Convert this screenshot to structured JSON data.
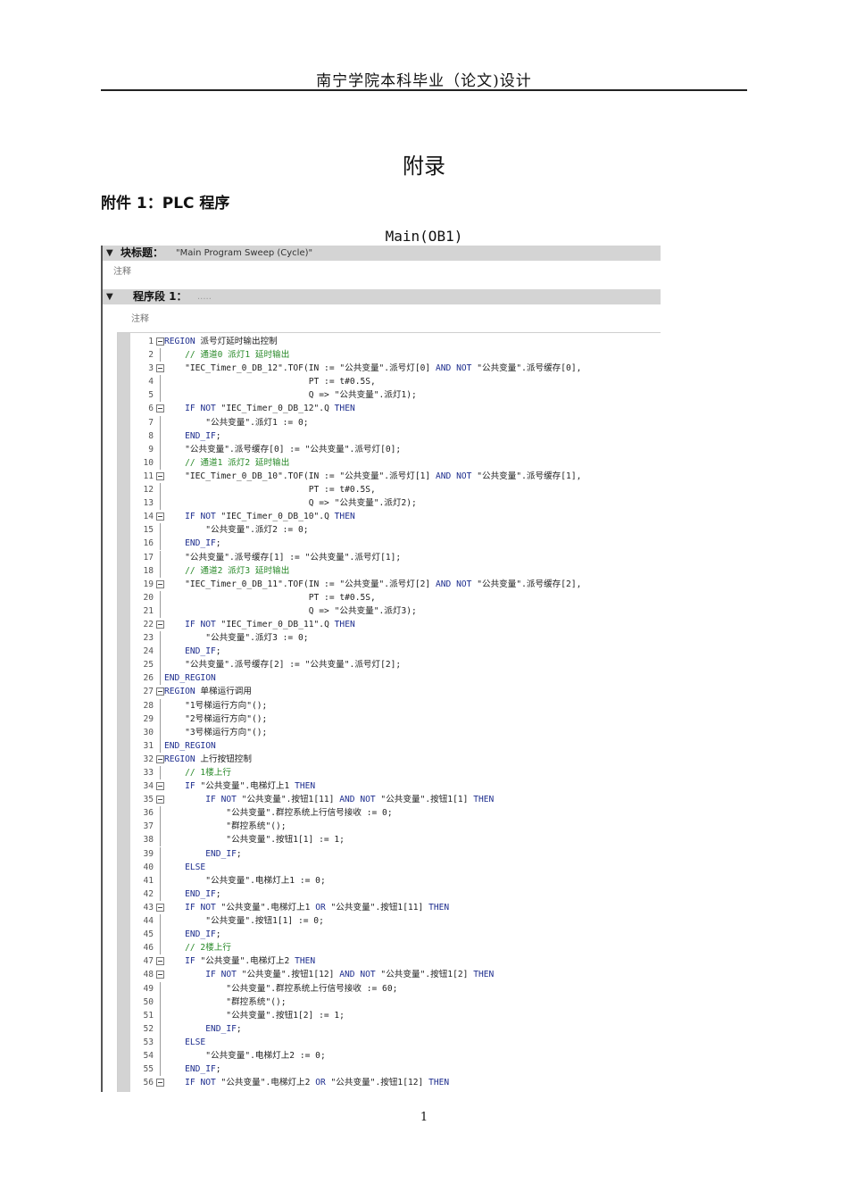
{
  "header": {
    "title": "南宁学院本科毕业（论文)设计"
  },
  "appendix_title": "附录",
  "attachment_title": "附件 1：PLC 程序",
  "figure_title": "Main(OB1)",
  "block": {
    "title_label": "块标题：",
    "title_value": "\"Main Program Sweep (Cycle)\"",
    "comment": "注释"
  },
  "network": {
    "label": "程序段 1：",
    "placeholder": ".....",
    "comment": "注释"
  },
  "code_lines": [
    {
      "n": "1",
      "t": "REGION 派号灯延时输出控制",
      "fold": true,
      "s": "kw"
    },
    {
      "n": "2",
      "t": "    // 通道0 派灯1 延时输出",
      "s": "cm"
    },
    {
      "n": "3",
      "t": "    \"IEC_Timer_0_DB_12\".TOF(IN := \"公共变量\".派号灯[0] AND NOT \"公共变量\".派号缓存[0],",
      "fold": true
    },
    {
      "n": "4",
      "t": "                            PT := t#0.5S,"
    },
    {
      "n": "5",
      "t": "                            Q => \"公共变量\".派灯1);"
    },
    {
      "n": "6",
      "t": "    IF NOT \"IEC_Timer_0_DB_12\".Q THEN",
      "fold": true
    },
    {
      "n": "7",
      "t": "        \"公共变量\".派灯1 := 0;"
    },
    {
      "n": "8",
      "t": "    END_IF;"
    },
    {
      "n": "9",
      "t": "    \"公共变量\".派号缓存[0] := \"公共变量\".派号灯[0];"
    },
    {
      "n": "10",
      "t": "    // 通道1 派灯2 延时输出",
      "s": "cm"
    },
    {
      "n": "11",
      "t": "    \"IEC_Timer_0_DB_10\".TOF(IN := \"公共变量\".派号灯[1] AND NOT \"公共变量\".派号缓存[1],",
      "fold": true
    },
    {
      "n": "12",
      "t": "                            PT := t#0.5S,"
    },
    {
      "n": "13",
      "t": "                            Q => \"公共变量\".派灯2);"
    },
    {
      "n": "14",
      "t": "    IF NOT \"IEC_Timer_0_DB_10\".Q THEN",
      "fold": true
    },
    {
      "n": "15",
      "t": "        \"公共变量\".派灯2 := 0;"
    },
    {
      "n": "16",
      "t": "    END_IF;"
    },
    {
      "n": "17",
      "t": "    \"公共变量\".派号缓存[1] := \"公共变量\".派号灯[1];"
    },
    {
      "n": "18",
      "t": "    // 通道2 派灯3 延时输出",
      "s": "cm"
    },
    {
      "n": "19",
      "t": "    \"IEC_Timer_0_DB_11\".TOF(IN := \"公共变量\".派号灯[2] AND NOT \"公共变量\".派号缓存[2],",
      "fold": true
    },
    {
      "n": "20",
      "t": "                            PT := t#0.5S,"
    },
    {
      "n": "21",
      "t": "                            Q => \"公共变量\".派灯3);"
    },
    {
      "n": "22",
      "t": "    IF NOT \"IEC_Timer_0_DB_11\".Q THEN",
      "fold": true
    },
    {
      "n": "23",
      "t": "        \"公共变量\".派灯3 := 0;"
    },
    {
      "n": "24",
      "t": "    END_IF;"
    },
    {
      "n": "25",
      "t": "    \"公共变量\".派号缓存[2] := \"公共变量\".派号灯[2];"
    },
    {
      "n": "26",
      "t": "END_REGION",
      "s": "kw"
    },
    {
      "n": "27",
      "t": "REGION 单梯运行调用",
      "fold": true,
      "s": "kw"
    },
    {
      "n": "28",
      "t": "    \"1号梯运行方向\"();"
    },
    {
      "n": "29",
      "t": "    \"2号梯运行方向\"();"
    },
    {
      "n": "30",
      "t": "    \"3号梯运行方向\"();"
    },
    {
      "n": "31",
      "t": "END_REGION",
      "s": "kw"
    },
    {
      "n": "32",
      "t": "REGION 上行按钮控制",
      "fold": true,
      "s": "kw"
    },
    {
      "n": "33",
      "t": "    // 1楼上行",
      "s": "cm"
    },
    {
      "n": "34",
      "t": "    IF \"公共变量\".电梯灯上1 THEN",
      "fold": true
    },
    {
      "n": "35",
      "t": "        IF NOT \"公共变量\".按钮1[11] AND NOT \"公共变量\".按钮1[1] THEN",
      "fold": true
    },
    {
      "n": "36",
      "t": "            \"公共变量\".群控系统上行信号接收 := 0;"
    },
    {
      "n": "37",
      "t": "            \"群控系统\"();"
    },
    {
      "n": "38",
      "t": "            \"公共变量\".按钮1[1] := 1;"
    },
    {
      "n": "39",
      "t": "        END_IF;"
    },
    {
      "n": "40",
      "t": "    ELSE"
    },
    {
      "n": "41",
      "t": "        \"公共变量\".电梯灯上1 := 0;"
    },
    {
      "n": "42",
      "t": "    END_IF;"
    },
    {
      "n": "43",
      "t": "    IF NOT \"公共变量\".电梯灯上1 OR \"公共变量\".按钮1[11] THEN",
      "fold": true
    },
    {
      "n": "44",
      "t": "        \"公共变量\".按钮1[1] := 0;"
    },
    {
      "n": "45",
      "t": "    END_IF;"
    },
    {
      "n": "46",
      "t": "    // 2楼上行",
      "s": "cm"
    },
    {
      "n": "47",
      "t": "    IF \"公共变量\".电梯灯上2 THEN",
      "fold": true
    },
    {
      "n": "48",
      "t": "        IF NOT \"公共变量\".按钮1[12] AND NOT \"公共变量\".按钮1[2] THEN",
      "fold": true
    },
    {
      "n": "49",
      "t": "            \"公共变量\".群控系统上行信号接收 := 60;"
    },
    {
      "n": "50",
      "t": "            \"群控系统\"();"
    },
    {
      "n": "51",
      "t": "            \"公共变量\".按钮1[2] := 1;"
    },
    {
      "n": "52",
      "t": "        END_IF;"
    },
    {
      "n": "53",
      "t": "    ELSE"
    },
    {
      "n": "54",
      "t": "        \"公共变量\".电梯灯上2 := 0;"
    },
    {
      "n": "55",
      "t": "    END_IF;"
    },
    {
      "n": "56",
      "t": "    IF NOT \"公共变量\".电梯灯上2 OR \"公共变量\".按钮1[12] THEN",
      "fold": true
    }
  ],
  "page_number": "1"
}
